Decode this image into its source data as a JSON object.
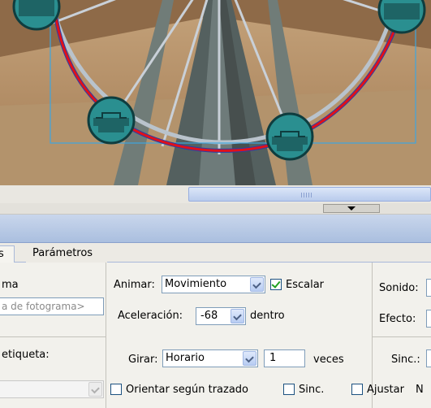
{
  "tabs": [
    {
      "label": "s"
    },
    {
      "label": "Parámetros"
    }
  ],
  "frame": {
    "name_label": "ma",
    "name_placeholder": "a de fotograma>",
    "label_type_label": "etiqueta:"
  },
  "tween": {
    "animate_label": "Animar:",
    "animate_value": "Movimiento",
    "scale_label": "Escalar",
    "scale_checked": true,
    "ease_label": "Aceleración:",
    "ease_value": "-68",
    "ease_suffix": "dentro",
    "rotate_label": "Girar:",
    "rotate_value": "Horario",
    "times_value": "1",
    "times_label": "veces",
    "orient_label": "Orientar según trazado",
    "sync_label": "Sinc.",
    "snap_label": "Ajustar",
    "snap_trailing": "N"
  },
  "sound": {
    "sound_label": "Sonido:",
    "effect_label": "Efecto:",
    "sync_label": "Sinc.:"
  },
  "colors": {
    "panel_header": "#aabfdf",
    "path_red": "#e0101a",
    "cabin": "#2a8f90"
  }
}
